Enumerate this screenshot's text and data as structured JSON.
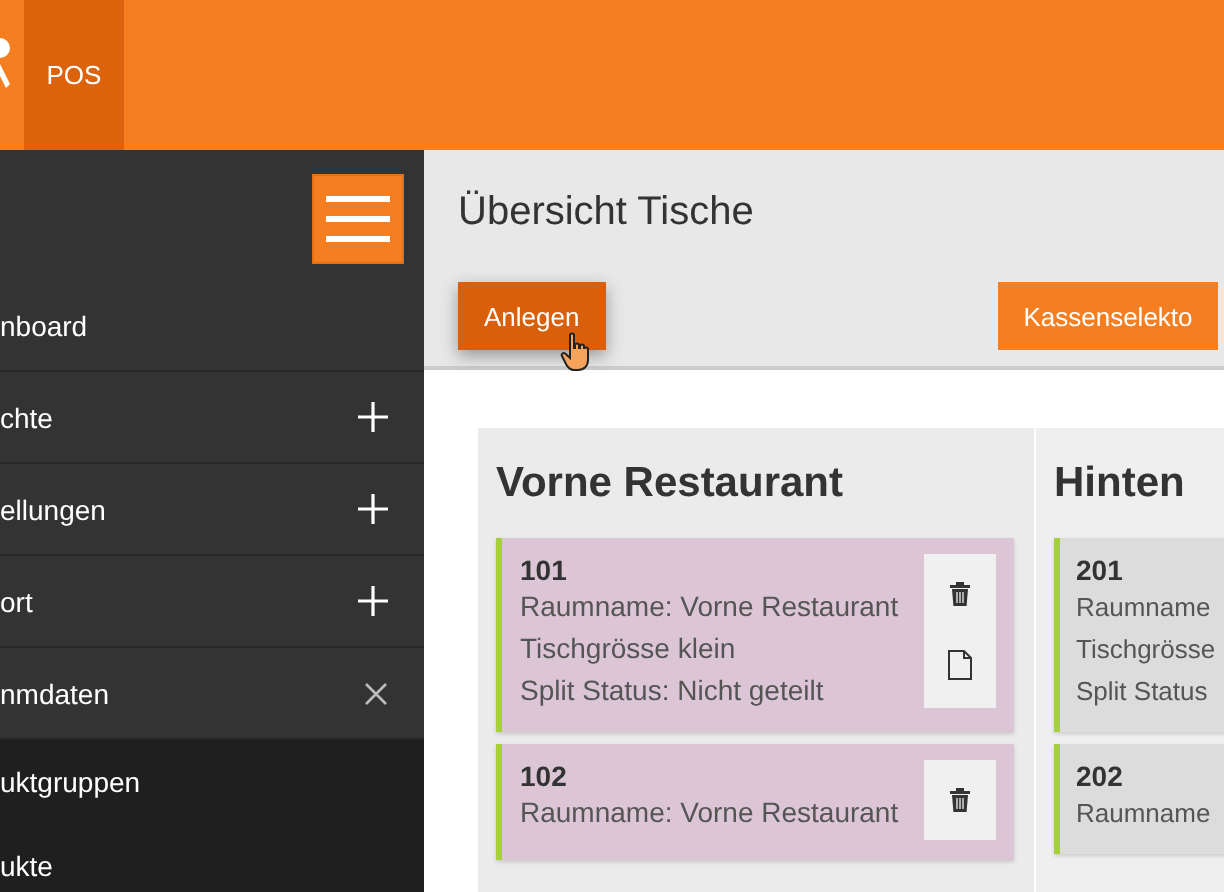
{
  "topbar": {
    "tab": "POS"
  },
  "sidebar": {
    "items": [
      {
        "label": "nboard",
        "kind": "link"
      },
      {
        "label": "chte",
        "kind": "group",
        "expanded": false
      },
      {
        "label": "ellungen",
        "kind": "group",
        "expanded": false
      },
      {
        "label": "ort",
        "kind": "group",
        "expanded": false
      },
      {
        "label": "nmdaten",
        "kind": "group",
        "expanded": true,
        "children": [
          {
            "label": "uktgruppen"
          },
          {
            "label": "ukte"
          }
        ]
      }
    ]
  },
  "page": {
    "title": "Übersicht Tische",
    "buttons": [
      {
        "label": "Anlegen",
        "hovered": true
      },
      {
        "label": "Kassenselekto",
        "hovered": false
      }
    ]
  },
  "rooms": [
    {
      "name": "Vorne Restaurant",
      "tables": [
        {
          "number": "101",
          "color": "#dcc6d6",
          "lines": [
            "Raumname: Vorne Restaurant",
            "Tischgrösse klein",
            "Split Status: Nicht geteilt"
          ],
          "actions": [
            {
              "kind": "delete"
            },
            {
              "kind": "document"
            }
          ]
        },
        {
          "number": "102",
          "color": "#dcc6d6",
          "lines": [
            "Raumname: Vorne Restaurant"
          ],
          "actions": [
            {
              "kind": "delete"
            }
          ]
        }
      ]
    },
    {
      "name": "Hinten",
      "tables": [
        {
          "number": "201",
          "color": "#dcdcdc",
          "lines": [
            "Raumname",
            "Tischgrösse",
            "Split Status"
          ]
        },
        {
          "number": "202",
          "color": "#dcdcdc",
          "lines": [
            "Raumname"
          ]
        }
      ]
    }
  ]
}
